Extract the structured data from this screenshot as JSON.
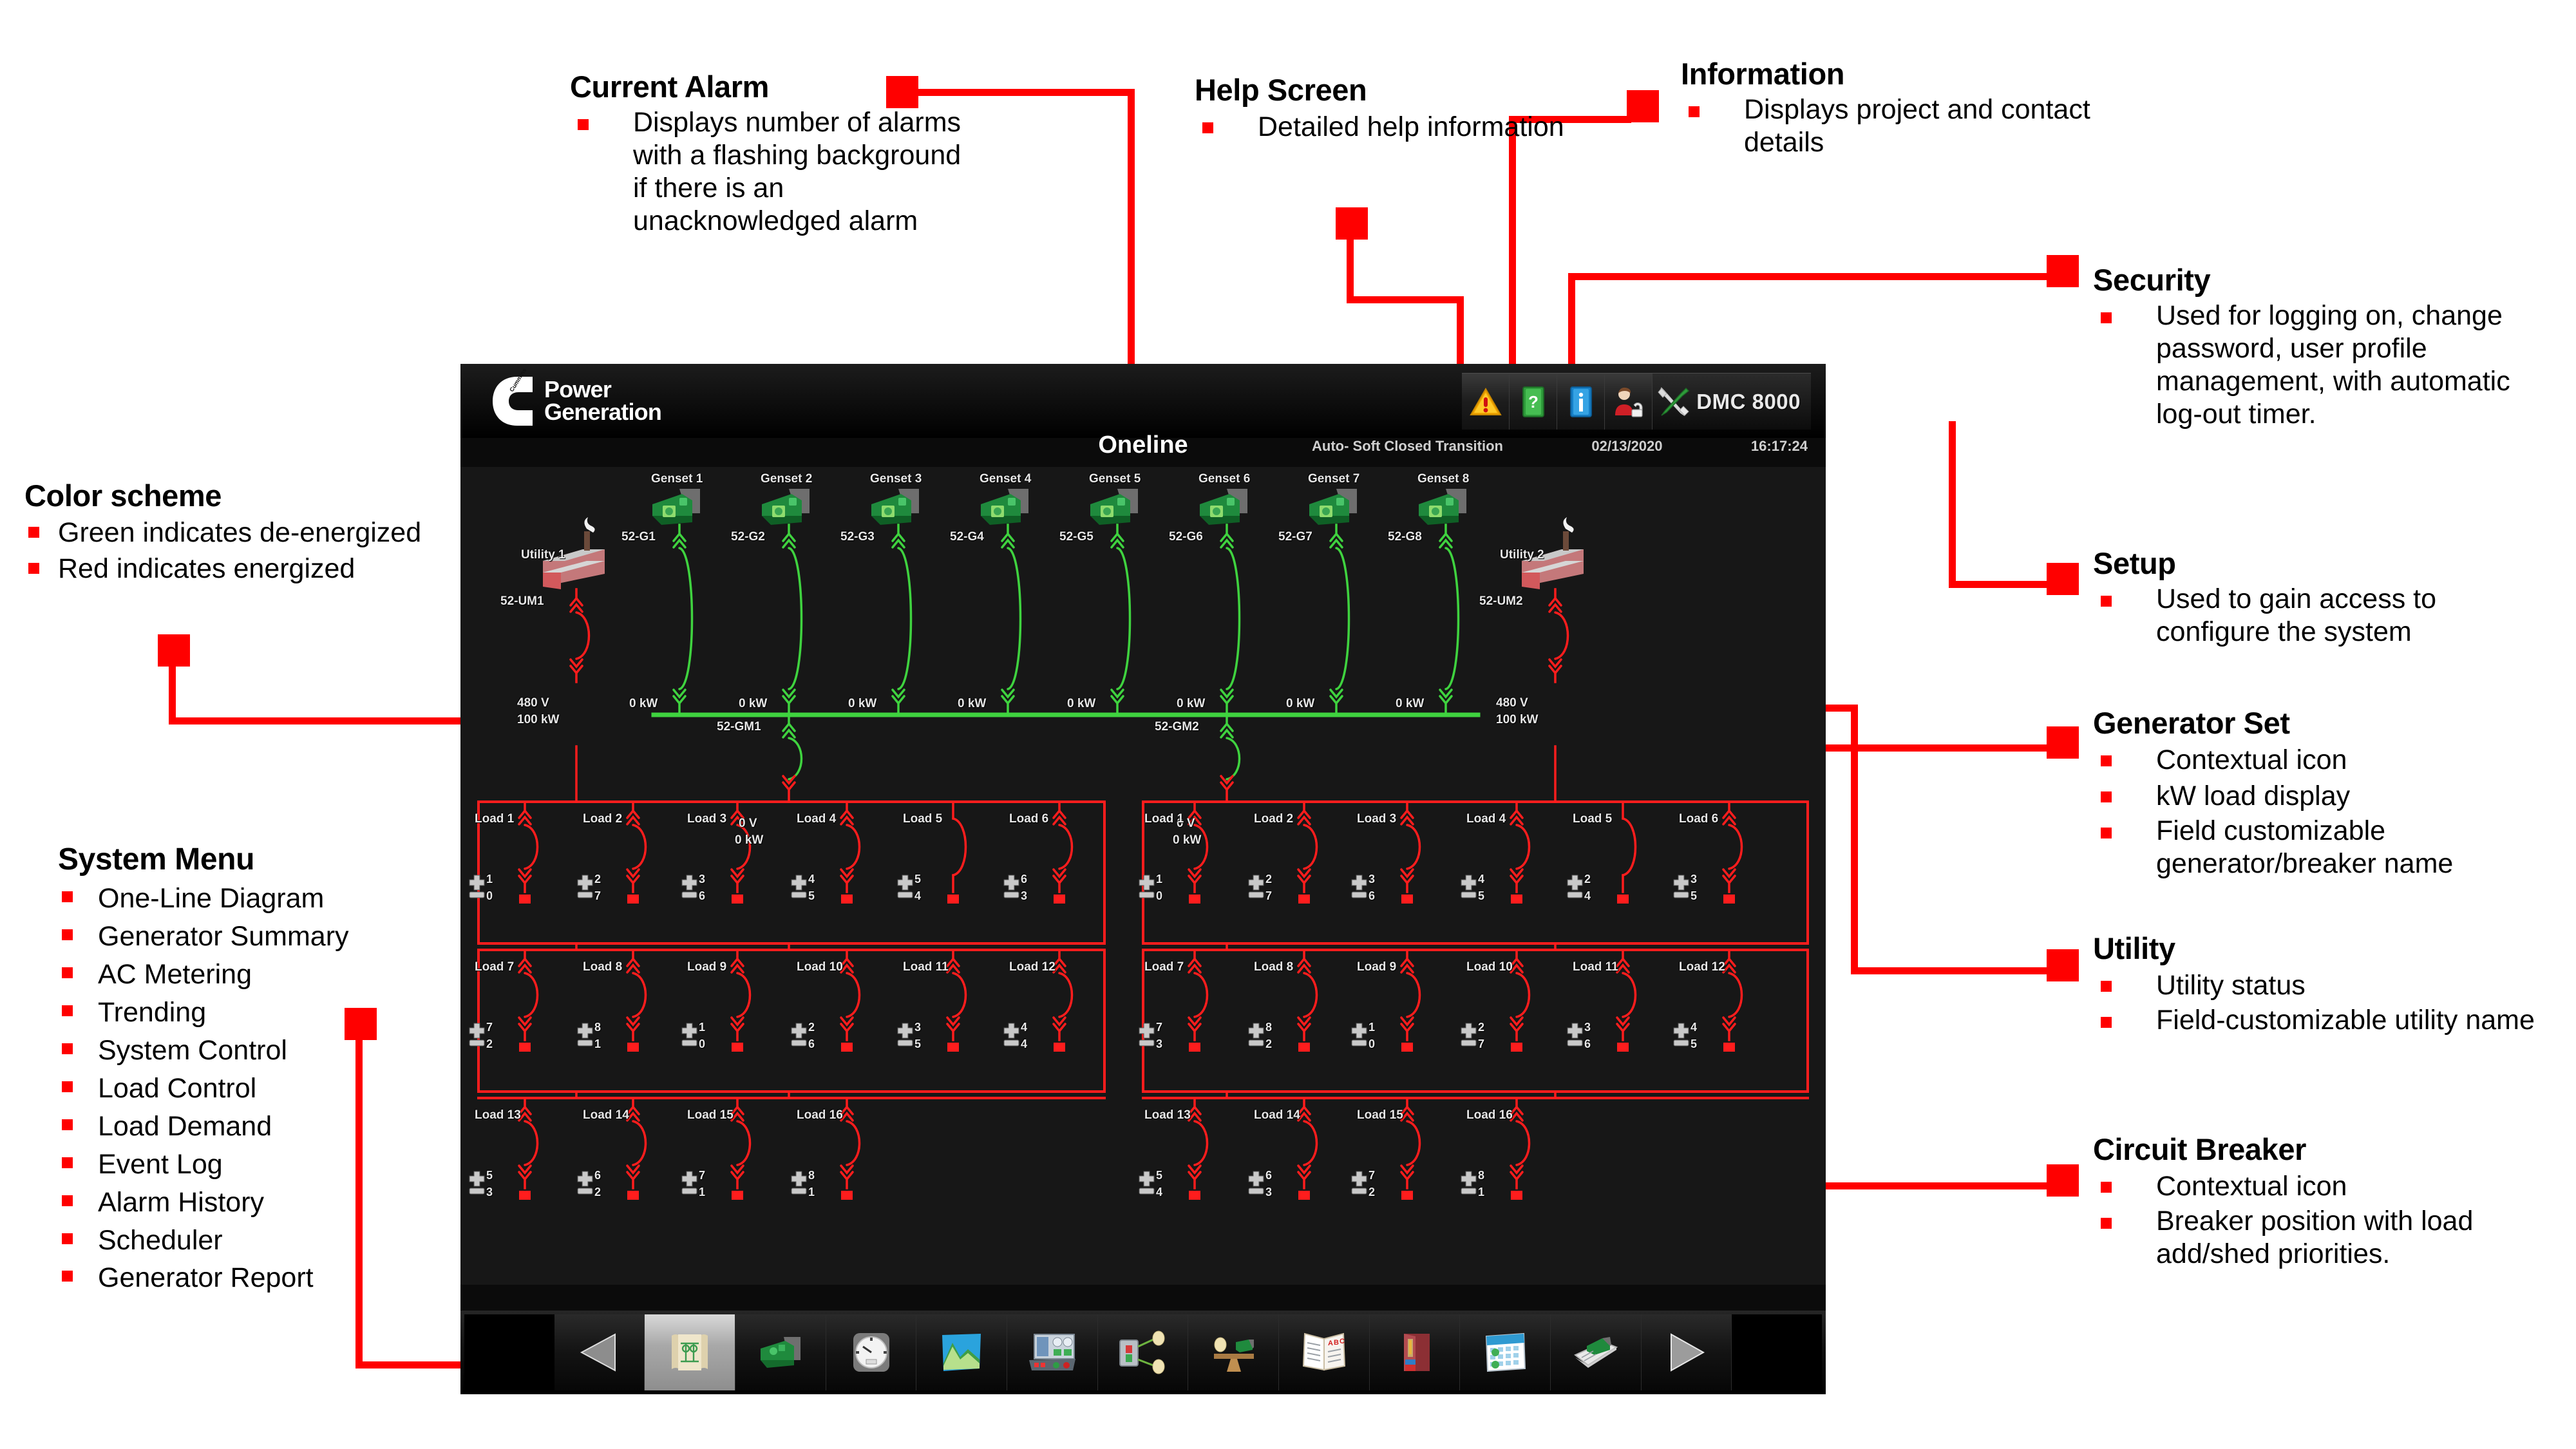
{
  "device": {
    "brand_line1": "Power",
    "brand_line2": "Generation",
    "model": "DMC 8000",
    "screen_title": "Oneline",
    "status": {
      "mode": "Auto- Soft Closed Transition",
      "date": "02/13/2020",
      "time": "16:17:24"
    },
    "toolbar": [
      {
        "name": "alarm-warning-icon",
        "label": "Current Alarm"
      },
      {
        "name": "help-book-icon",
        "label": "Help Screen"
      },
      {
        "name": "information-icon",
        "label": "Information"
      },
      {
        "name": "security-user-icon",
        "label": "Security"
      },
      {
        "name": "setup-tools-icon",
        "label": "Setup"
      }
    ],
    "nav": [
      {
        "name": "prev-arrow-icon",
        "label": "Previous"
      },
      {
        "name": "one-line-diagram-icon",
        "label": "One-Line Diagram"
      },
      {
        "name": "generator-summary-icon",
        "label": "Generator Summary"
      },
      {
        "name": "ac-metering-icon",
        "label": "AC Metering"
      },
      {
        "name": "trending-icon",
        "label": "Trending"
      },
      {
        "name": "system-control-icon",
        "label": "System Control"
      },
      {
        "name": "load-control-icon",
        "label": "Load Control"
      },
      {
        "name": "load-demand-icon",
        "label": "Load Demand"
      },
      {
        "name": "event-log-icon",
        "label": "Event Log"
      },
      {
        "name": "alarm-history-icon",
        "label": "Alarm History"
      },
      {
        "name": "scheduler-icon",
        "label": "Scheduler"
      },
      {
        "name": "generator-report-icon",
        "label": "Generator Report"
      },
      {
        "name": "next-arrow-icon",
        "label": "Next"
      }
    ],
    "colors": {
      "energized": "#ff1d1d",
      "de_energized": "#3fd33f",
      "accent_red": "#ff0000",
      "panel_bg": "#171717"
    }
  },
  "oneline": {
    "gensets": [
      {
        "name": "Genset 1",
        "breaker": "52-G1",
        "kw": "0 kW"
      },
      {
        "name": "Genset 2",
        "breaker": "52-G2",
        "kw": "0 kW"
      },
      {
        "name": "Genset 3",
        "breaker": "52-G3",
        "kw": "0 kW"
      },
      {
        "name": "Genset 4",
        "breaker": "52-G4",
        "kw": "0 kW"
      },
      {
        "name": "Genset 5",
        "breaker": "52-G5",
        "kw": "0 kW"
      },
      {
        "name": "Genset 6",
        "breaker": "52-G6",
        "kw": "0 kW"
      },
      {
        "name": "Genset 7",
        "breaker": "52-G7",
        "kw": "0 kW"
      },
      {
        "name": "Genset 8",
        "breaker": "52-G8",
        "kw": "0 kW"
      }
    ],
    "utilities": [
      {
        "name": "Utility 1",
        "breaker": "52-UM1",
        "volts": "480 V",
        "kw": "100 kW"
      },
      {
        "name": "Utility 2",
        "breaker": "52-UM2",
        "volts": "480 V",
        "kw": "100 kW"
      }
    ],
    "main_breakers": [
      {
        "breaker": "52-GM1",
        "volts": "0 V",
        "kw": "0 kW"
      },
      {
        "breaker": "52-GM2",
        "volts": "0 V",
        "kw": "0 kW"
      }
    ],
    "load_groups": [
      {
        "side": "left",
        "rows": [
          {
            "loads": [
              {
                "label": "Load 1",
                "add": "1",
                "shed": "0",
                "closed": true
              },
              {
                "label": "Load 2",
                "add": "2",
                "shed": "7",
                "closed": true
              },
              {
                "label": "Load 3",
                "add": "3",
                "shed": "6",
                "closed": true
              },
              {
                "label": "Load 4",
                "add": "4",
                "shed": "5",
                "closed": true
              },
              {
                "label": "Load 5",
                "add": "5",
                "shed": "4",
                "closed": false
              },
              {
                "label": "Load 6",
                "add": "6",
                "shed": "3",
                "closed": true
              }
            ]
          },
          {
            "loads": [
              {
                "label": "Load 7",
                "add": "7",
                "shed": "2",
                "closed": true
              },
              {
                "label": "Load 8",
                "add": "8",
                "shed": "1",
                "closed": true
              },
              {
                "label": "Load 9",
                "add": "1",
                "shed": "0",
                "closed": true
              },
              {
                "label": "Load 10",
                "add": "2",
                "shed": "6",
                "closed": true
              },
              {
                "label": "Load 11",
                "add": "3",
                "shed": "5",
                "closed": true
              },
              {
                "label": "Load 12",
                "add": "4",
                "shed": "4",
                "closed": true
              }
            ]
          },
          {
            "loads": [
              {
                "label": "Load 13",
                "add": "5",
                "shed": "3",
                "closed": true
              },
              {
                "label": "Load 14",
                "add": "6",
                "shed": "2",
                "closed": true
              },
              {
                "label": "Load 15",
                "add": "7",
                "shed": "1",
                "closed": true
              },
              {
                "label": "Load 16",
                "add": "8",
                "shed": "1",
                "closed": true
              }
            ]
          }
        ]
      },
      {
        "side": "right",
        "rows": [
          {
            "loads": [
              {
                "label": "Load 1",
                "add": "1",
                "shed": "0",
                "closed": true
              },
              {
                "label": "Load 2",
                "add": "2",
                "shed": "7",
                "closed": true
              },
              {
                "label": "Load 3",
                "add": "3",
                "shed": "6",
                "closed": true
              },
              {
                "label": "Load 4",
                "add": "4",
                "shed": "5",
                "closed": true
              },
              {
                "label": "Load 5",
                "add": "2",
                "shed": "4",
                "closed": false
              },
              {
                "label": "Load 6",
                "add": "3",
                "shed": "5",
                "closed": true
              }
            ]
          },
          {
            "loads": [
              {
                "label": "Load 7",
                "add": "7",
                "shed": "3",
                "closed": true
              },
              {
                "label": "Load 8",
                "add": "8",
                "shed": "2",
                "closed": true
              },
              {
                "label": "Load 9",
                "add": "1",
                "shed": "0",
                "closed": true
              },
              {
                "label": "Load 10",
                "add": "2",
                "shed": "7",
                "closed": true
              },
              {
                "label": "Load 11",
                "add": "3",
                "shed": "6",
                "closed": true
              },
              {
                "label": "Load 12",
                "add": "4",
                "shed": "5",
                "closed": true
              }
            ]
          },
          {
            "loads": [
              {
                "label": "Load 13",
                "add": "5",
                "shed": "4",
                "closed": true
              },
              {
                "label": "Load 14",
                "add": "6",
                "shed": "3",
                "closed": true
              },
              {
                "label": "Load 15",
                "add": "7",
                "shed": "2",
                "closed": true
              },
              {
                "label": "Load 16",
                "add": "8",
                "shed": "1",
                "closed": true
              }
            ]
          }
        ]
      }
    ]
  },
  "callouts": {
    "current_alarm": {
      "title": "Current Alarm",
      "bullets": [
        "Displays number of alarms with a flashing background if there is an unacknowledged alarm"
      ]
    },
    "help_screen": {
      "title": "Help Screen",
      "bullets": [
        "Detailed help information"
      ]
    },
    "information": {
      "title": "Information",
      "bullets": [
        "Displays project and contact details"
      ]
    },
    "security": {
      "title": "Security",
      "bullets": [
        "Used for logging on, change password, user profile management, with automatic log-out timer."
      ]
    },
    "setup": {
      "title": "Setup",
      "bullets": [
        "Used to gain access to configure the system"
      ]
    },
    "generator_set": {
      "title": "Generator Set",
      "bullets": [
        "Contextual icon",
        "kW load display",
        "Field customizable generator/breaker name"
      ]
    },
    "utility": {
      "title": "Utility",
      "bullets": [
        "Utility status",
        "Field-customizable utility name"
      ]
    },
    "circuit_breaker": {
      "title": "Circuit Breaker",
      "bullets": [
        "Contextual icon",
        "Breaker position with load add/shed priorities."
      ]
    },
    "color_scheme": {
      "title": "Color scheme",
      "bullets": [
        "Green indicates de-energized",
        "Red indicates energized"
      ]
    },
    "system_menu": {
      "title": "System Menu",
      "bullets": [
        "One-Line Diagram",
        "Generator Summary",
        "AC Metering",
        "Trending",
        "System Control",
        "Load Control",
        "Load Demand",
        "Event Log",
        "Alarm History",
        "Scheduler",
        "Generator Report"
      ]
    }
  }
}
